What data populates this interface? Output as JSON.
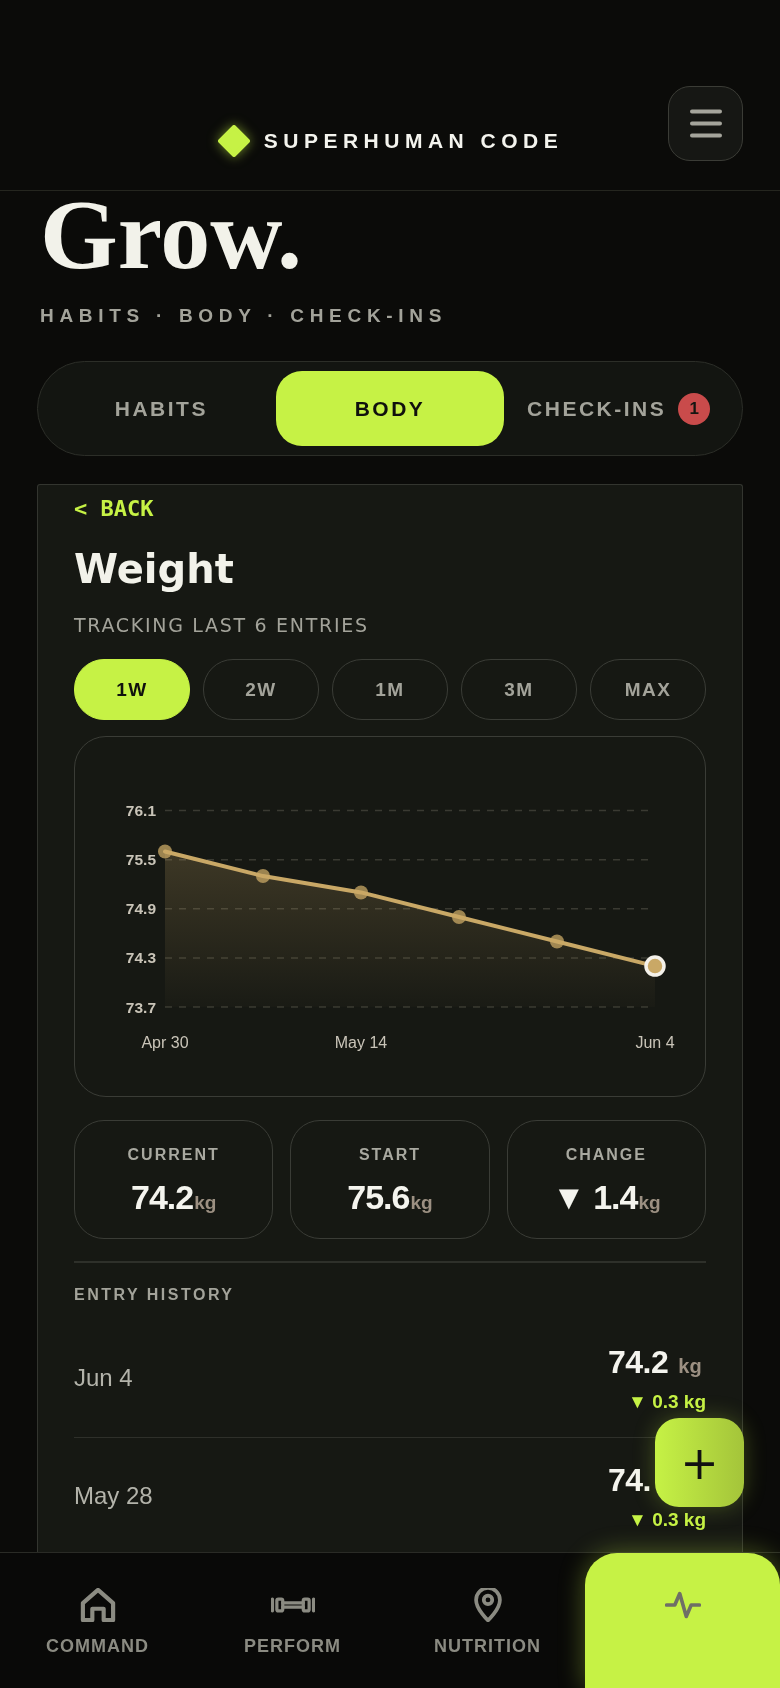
{
  "header": {
    "brand": "SUPERHUMAN CODE"
  },
  "page": {
    "title": "Grow.",
    "subtitle": "HABITS · BODY · CHECK-INS"
  },
  "tabs": [
    {
      "label": "HABITS",
      "selected": false
    },
    {
      "label": "BODY",
      "selected": true
    },
    {
      "label": "CHECK-INS",
      "selected": false,
      "badge": "1"
    }
  ],
  "detail": {
    "back": "< BACK",
    "title": "Weight",
    "subtitle": "TRACKING LAST 6 ENTRIES",
    "ranges": [
      {
        "label": "1W",
        "selected": true
      },
      {
        "label": "2W",
        "selected": false
      },
      {
        "label": "1M",
        "selected": false
      },
      {
        "label": "3M",
        "selected": false
      },
      {
        "label": "MAX",
        "selected": false
      }
    ],
    "chart_data": {
      "type": "area",
      "categories": [
        "Apr 30",
        null,
        "May 14",
        null,
        null,
        "Jun 4"
      ],
      "ylim": [
        73.7,
        76.1
      ],
      "yticks": [
        73.7,
        74.3,
        74.9,
        75.5,
        76.1
      ],
      "grid": true,
      "series": [
        {
          "color": "#c9a866",
          "values": [
            75.6,
            75.3,
            75.1,
            74.8,
            74.5,
            74.2
          ]
        }
      ]
    },
    "stats": [
      {
        "label": "CURRENT",
        "value": "74.2",
        "unit": "kg"
      },
      {
        "label": "START",
        "value": "75.6",
        "unit": "kg"
      },
      {
        "label": "CHANGE",
        "value": "▼ 1.4",
        "unit": "kg"
      }
    ],
    "history_title": "ENTRY HISTORY",
    "history": [
      {
        "date": "Jun 4",
        "value": "74.2",
        "unit": "kg",
        "change": "▼ 0.3 kg"
      },
      {
        "date": "May 28",
        "value": "74.",
        "change": "▼ 0.3 kg"
      }
    ]
  },
  "fab": {
    "label": "+"
  },
  "nav": [
    {
      "label": "COMMAND",
      "selected": false
    },
    {
      "label": "PERFORM",
      "selected": false
    },
    {
      "label": "NUTRITION",
      "selected": false
    },
    {
      "selected": true
    }
  ]
}
